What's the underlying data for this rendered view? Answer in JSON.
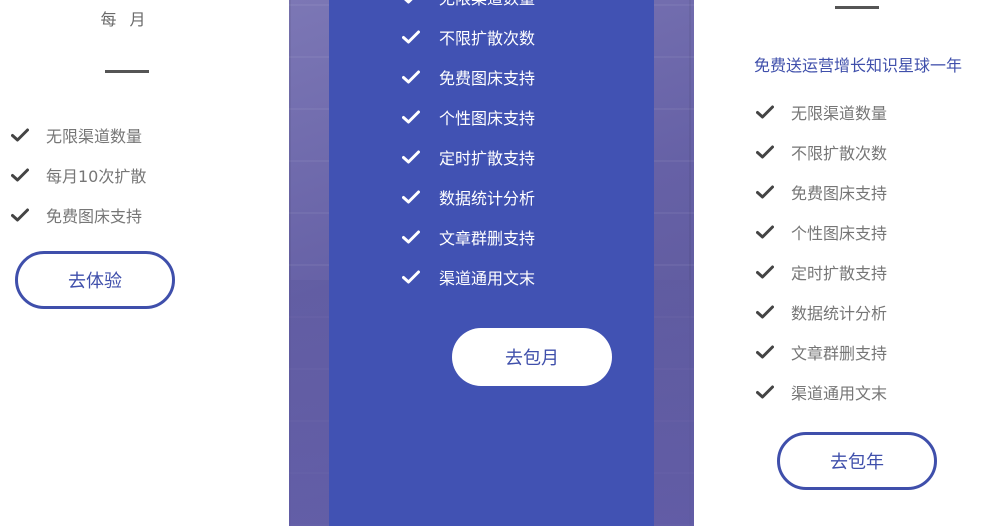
{
  "colors": {
    "accent": "#3f4fab",
    "card_bg": "#4152b3",
    "text_muted": "#767676",
    "check_dark": "#444444",
    "white": "#ffffff"
  },
  "left_plan": {
    "period": "每 月",
    "features": [
      "无限渠道数量",
      "每月10次扩散",
      "免费图床支持"
    ],
    "button": "去体验"
  },
  "center_plan": {
    "features": [
      "无限渠道数量",
      "不限扩散次数",
      "免费图床支持",
      "个性图床支持",
      "定时扩散支持",
      "数据统计分析",
      "文章群删支持",
      "渠道通用文末"
    ],
    "button": "去包月"
  },
  "right_plan": {
    "bonus": "免费送运营增长知识星球一年",
    "features": [
      "无限渠道数量",
      "不限扩散次数",
      "免费图床支持",
      "个性图床支持",
      "定时扩散支持",
      "数据统计分析",
      "文章群删支持",
      "渠道通用文末"
    ],
    "button": "去包年"
  },
  "icons": {
    "feature_marker": "check-icon"
  }
}
